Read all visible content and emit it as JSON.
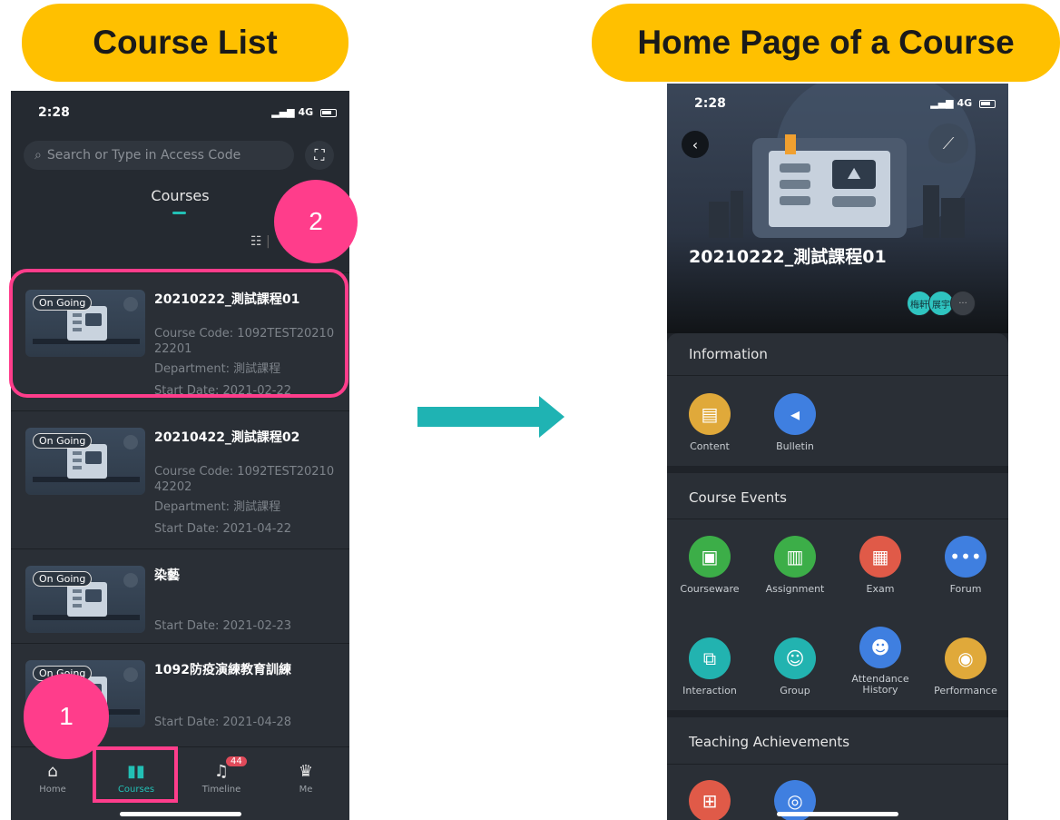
{
  "labels": {
    "left": "Course List",
    "right": "Home Page of a Course"
  },
  "steps": {
    "one": "1",
    "two": "2"
  },
  "list_screen": {
    "time": "2:28",
    "network": "4G",
    "search_placeholder": "Search or Type in Access Code",
    "title": "Courses",
    "courses": [
      {
        "status": "On Going",
        "title": "20210222_測試課程01",
        "code": "Course Code: 1092TEST2021022201",
        "department": "Department: 測試課程",
        "start": "Start Date: 2021-02-22"
      },
      {
        "status": "On Going",
        "title": "20210422_測試課程02",
        "code": "Course Code: 1092TEST2021042202",
        "department": "Department: 測試課程",
        "start": "Start Date: 2021-04-22"
      },
      {
        "status": "On Going",
        "title": "染藝",
        "start": "Start Date: 2021-02-23"
      },
      {
        "status": "On Going",
        "title": "1092防疫演練教育訓練",
        "start": "Start Date: 2021-04-28"
      }
    ],
    "tabs": [
      {
        "label": "Home"
      },
      {
        "label": "Courses"
      },
      {
        "label": "Timeline",
        "badge": "44"
      },
      {
        "label": "Me"
      }
    ]
  },
  "course_screen": {
    "time": "2:28",
    "network": "4G",
    "course_name": "20210222_測試課程01",
    "avatars": [
      "梅軒",
      "展宇"
    ],
    "more_avatars": "···",
    "sections": [
      {
        "title": "Information",
        "items": [
          {
            "label": "Content",
            "color": "#e0a93a",
            "icon": "content-icon"
          },
          {
            "label": "Bulletin",
            "color": "#3f7fe0",
            "icon": "bulletin-icon"
          }
        ]
      },
      {
        "title": "Course Events",
        "items": [
          {
            "label": "Courseware",
            "color": "#3cae48",
            "icon": "courseware-icon"
          },
          {
            "label": "Assignment",
            "color": "#3cae48",
            "icon": "assignment-icon"
          },
          {
            "label": "Exam",
            "color": "#e05a48",
            "icon": "exam-icon"
          },
          {
            "label": "Forum",
            "color": "#3f7fe0",
            "icon": "forum-icon"
          },
          {
            "label": "Interaction",
            "color": "#22b3b0",
            "icon": "interaction-icon"
          },
          {
            "label": "Group",
            "color": "#22b3b0",
            "icon": "group-icon"
          },
          {
            "label": "Attendance History",
            "color": "#3f7fe0",
            "icon": "attendance-icon"
          },
          {
            "label": "Performance",
            "color": "#e0a93a",
            "icon": "performance-icon"
          }
        ]
      },
      {
        "title": "Teaching Achievements",
        "items": [
          {
            "color": "#e05a48",
            "icon": "score-icon"
          },
          {
            "color": "#3f7fe0",
            "icon": "achievement-icon"
          }
        ]
      }
    ]
  },
  "colors": {
    "highlight": "#ff3d8b",
    "label_pill": "#ffc000",
    "arrow": "#1fb3b3",
    "accent": "#22c0b5"
  }
}
